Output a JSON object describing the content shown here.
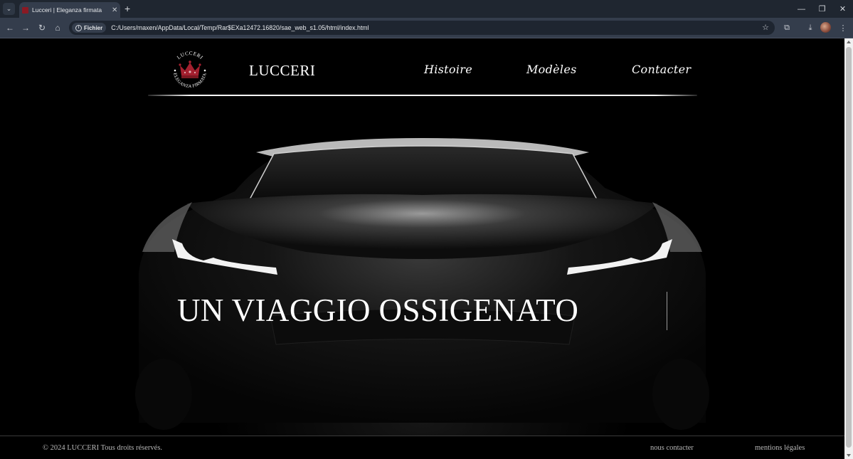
{
  "browser": {
    "tab_title": "Lucceri | Eleganza firmata",
    "new_tab": "+",
    "site_chip": "Fichier",
    "url": "C:/Users/maxen/AppData/Local/Temp/Rar$EXa12472.16820/sae_web_s1.05/html/index.html",
    "icons": [
      "tab-search-icon",
      "close-icon",
      "back-icon",
      "forward-icon",
      "reload-icon",
      "home-icon",
      "info-icon",
      "star-icon",
      "extensions-icon",
      "download-icon",
      "menu-icon",
      "minimize-icon",
      "restore-icon",
      "window-close-icon"
    ]
  },
  "site": {
    "logo": {
      "ring_text_top": "LUCCERI",
      "ring_text_bottom": "ELEGANZA FIRMATA",
      "icon": "crown-icon",
      "crown_color": "#a5202f"
    },
    "brand": "LUCCERI",
    "nav": [
      {
        "label": "Histoire"
      },
      {
        "label": "Modèles"
      },
      {
        "label": "Contacter"
      }
    ],
    "hero": {
      "title": "UN VIAGGIO OSSIGENATO"
    },
    "footer": {
      "copyright": "© 2024 LUCCERI Tous droits réservés.",
      "links": [
        {
          "label": "nous contacter"
        },
        {
          "label": "mentions légales"
        }
      ]
    }
  },
  "colors": {
    "background": "#000000",
    "text": "#ffffff",
    "footer_text": "#b9b9b9",
    "chrome": "#343d4c"
  }
}
